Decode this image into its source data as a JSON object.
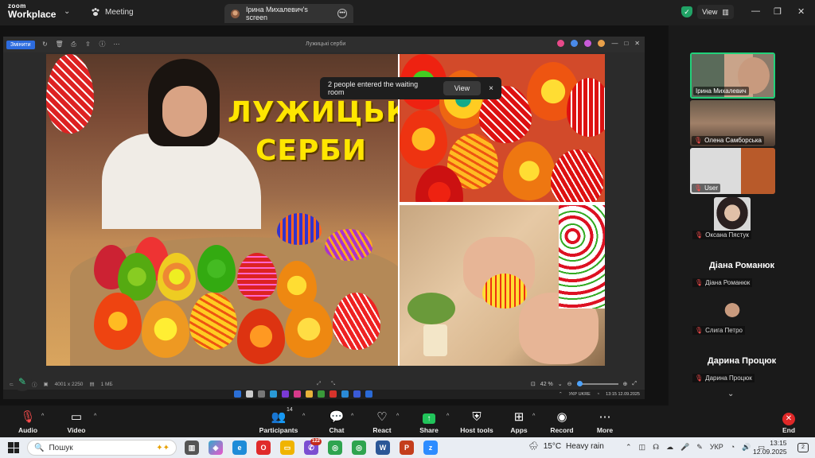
{
  "topbar": {
    "logo_line1": "zoom",
    "logo_line2": "Workplace",
    "meeting_label": "Meeting",
    "share_tab": "Ірина Михалевич's screen",
    "view_label": "View"
  },
  "shared_screen": {
    "edit_label": "Змінити",
    "filename": "Лужицькі серби",
    "waiting_room": {
      "message": "2 people entered the waiting room",
      "view_label": "View",
      "close": "×"
    },
    "slide_title_line1": "ЛУЖИЦЬКІ",
    "slide_title_line2": "СЕРБИ",
    "image_size": "4001 x 2250",
    "file_size": "1 МБ",
    "zoom_percent": "42 %",
    "remote_lang_top": "УКР",
    "remote_lang_bottom": "UKRE",
    "remote_time": "13:15",
    "remote_date": "12.09.2025"
  },
  "participants": [
    {
      "name": "Ірина Михалевич",
      "active": true,
      "muted": false
    },
    {
      "name": "Олена Самборська",
      "active": false,
      "muted": true
    },
    {
      "name": "User",
      "active": false,
      "muted": true
    },
    {
      "name": "Оксана Пястук",
      "active": false,
      "muted": true
    },
    {
      "name": "Діана Романюк",
      "big": "Діана Романюк",
      "muted": true
    },
    {
      "name": "Слига Петро",
      "active": false,
      "muted": true
    },
    {
      "name": "Дарина Процюк",
      "big": "Дарина Процюк",
      "muted": true
    }
  ],
  "toolbar": {
    "audio": "Audio",
    "video": "Video",
    "participants": "Participants",
    "participants_count": "14",
    "chat": "Chat",
    "react": "React",
    "share": "Share",
    "host_tools": "Host tools",
    "apps": "Apps",
    "record": "Record",
    "more": "More",
    "end": "End"
  },
  "taskbar": {
    "search_placeholder": "Пошук",
    "weather_temp": "15°C",
    "weather_desc": "Heavy rain",
    "lang": "УКР",
    "time": "13:15",
    "date": "12.09.2025",
    "notification_count": "2",
    "viber_badge": "122"
  },
  "colors": {
    "accent_green": "#22d17a",
    "slide_title": "#ffe600",
    "end_red": "#e02828",
    "share_green": "#21c45a"
  }
}
